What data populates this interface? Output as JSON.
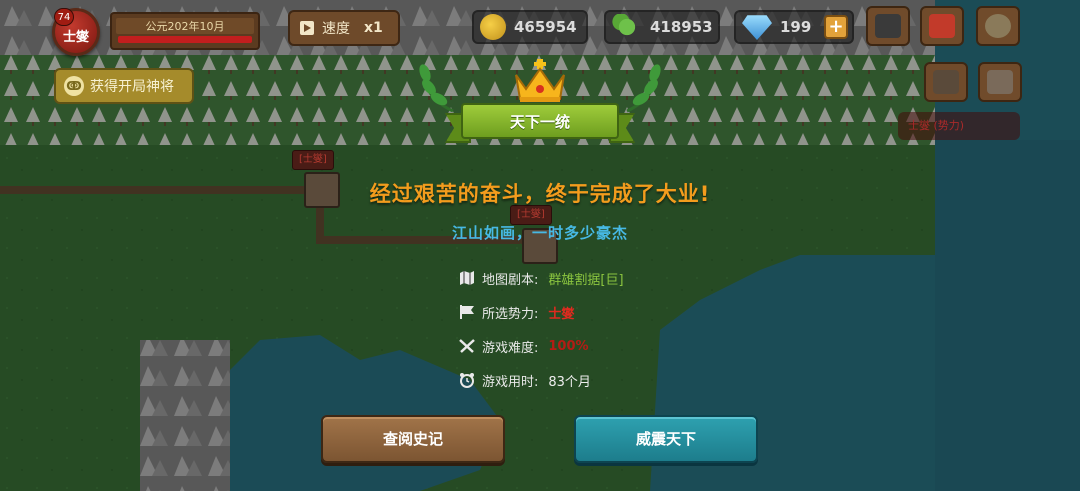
{
  "hud": {
    "lord_level": "74",
    "lord_name": "士燮",
    "date": "公元202年10月",
    "speed_label": "速度",
    "speed_value": "x1",
    "god_button": "获得开局神将",
    "god_icon_glyph": "ↂ"
  },
  "resources": {
    "gold": "465954",
    "clover": "418953",
    "gems": "199",
    "plus": "+"
  },
  "map_labels": {
    "city_tag_1": "[士燮]",
    "city_tag_2": "[士燮]",
    "red_tag": "士燮 (势力)"
  },
  "dialog": {
    "ribbon_title": "天下一统",
    "headline": "经过艰苦的奋斗，终于完成了大业!",
    "subline": "江山如画，一时多少豪杰",
    "stats": [
      {
        "label": "地图剧本:",
        "value": "群雄割据[巨]",
        "icon": "map-icon"
      },
      {
        "label": "所选势力:",
        "value": "士燮",
        "icon": "flag-icon"
      },
      {
        "label": "游戏难度:",
        "value": "100%",
        "icon": "swords-icon"
      },
      {
        "label": "游戏用时:",
        "value": "83个月",
        "icon": "alarm-clock-icon"
      }
    ],
    "btn_history": "查阅史记",
    "btn_glory": "威震天下"
  },
  "colors": {
    "headline": "#f39c1d",
    "subline": "#47b9e4",
    "value_green": "#8bc53f",
    "value_red": "#e02a1f",
    "btn_brown": "#8a603a",
    "btn_teal": "#2392a2"
  }
}
